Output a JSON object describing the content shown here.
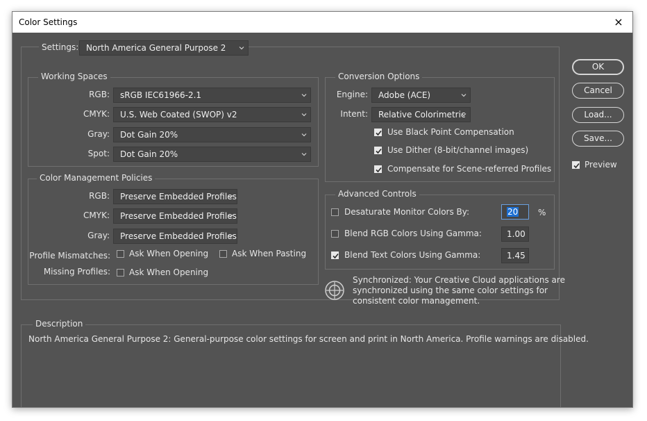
{
  "window": {
    "title": "Color Settings",
    "close_glyph": "×"
  },
  "settings": {
    "label": "Settings:",
    "value": "North America General Purpose 2"
  },
  "working_spaces": {
    "legend": "Working Spaces",
    "rgb": {
      "label": "RGB:",
      "value": "sRGB IEC61966-2.1"
    },
    "cmyk": {
      "label": "CMYK:",
      "value": "U.S. Web Coated (SWOP) v2"
    },
    "gray": {
      "label": "Gray:",
      "value": "Dot Gain 20%"
    },
    "spot": {
      "label": "Spot:",
      "value": "Dot Gain 20%"
    }
  },
  "policies": {
    "legend": "Color Management Policies",
    "rgb": {
      "label": "RGB:",
      "value": "Preserve Embedded Profiles"
    },
    "cmyk": {
      "label": "CMYK:",
      "value": "Preserve Embedded Profiles"
    },
    "gray": {
      "label": "Gray:",
      "value": "Preserve Embedded Profiles"
    },
    "profile_mismatches_label": "Profile Mismatches:",
    "ask_when_opening": {
      "label": "Ask When Opening",
      "checked": false
    },
    "ask_when_pasting": {
      "label": "Ask When Pasting",
      "checked": false
    },
    "missing_profiles_label": "Missing Profiles:",
    "missing_ask_when_opening": {
      "label": "Ask When Opening",
      "checked": false
    }
  },
  "conversion": {
    "legend": "Conversion Options",
    "engine": {
      "label": "Engine:",
      "value": "Adobe (ACE)"
    },
    "intent": {
      "label": "Intent:",
      "value": "Relative Colorimetric"
    },
    "black_point": {
      "label": "Use Black Point Compensation",
      "checked": true
    },
    "dither": {
      "label": "Use Dither (8-bit/channel images)",
      "checked": true
    },
    "scene_referred": {
      "label": "Compensate for Scene-referred Profiles",
      "checked": true
    }
  },
  "advanced": {
    "legend": "Advanced Controls",
    "desaturate": {
      "label": "Desaturate Monitor Colors By:",
      "checked": false,
      "value": "20",
      "unit": "%"
    },
    "blend_rgb": {
      "label": "Blend RGB Colors Using Gamma:",
      "checked": false,
      "value": "1.00"
    },
    "blend_text": {
      "label": "Blend Text Colors Using Gamma:",
      "checked": true,
      "value": "1.45"
    }
  },
  "sync": {
    "icon": "sync-target-icon",
    "text_line1": "Synchronized: Your Creative Cloud applications are",
    "text_line2": "synchronized using the same color settings for",
    "text_line3": "consistent color management."
  },
  "description": {
    "legend": "Description",
    "text": "North America General Purpose 2:  General-purpose color settings for screen and print in North America. Profile warnings are disabled."
  },
  "buttons": {
    "ok": "OK",
    "cancel": "Cancel",
    "load": "Load...",
    "save": "Save..."
  },
  "preview": {
    "label": "Preview",
    "checked": true
  },
  "colors": {
    "dialog_bg": "#535353",
    "field_bg": "#454545",
    "selection": "#1d6fd1"
  }
}
